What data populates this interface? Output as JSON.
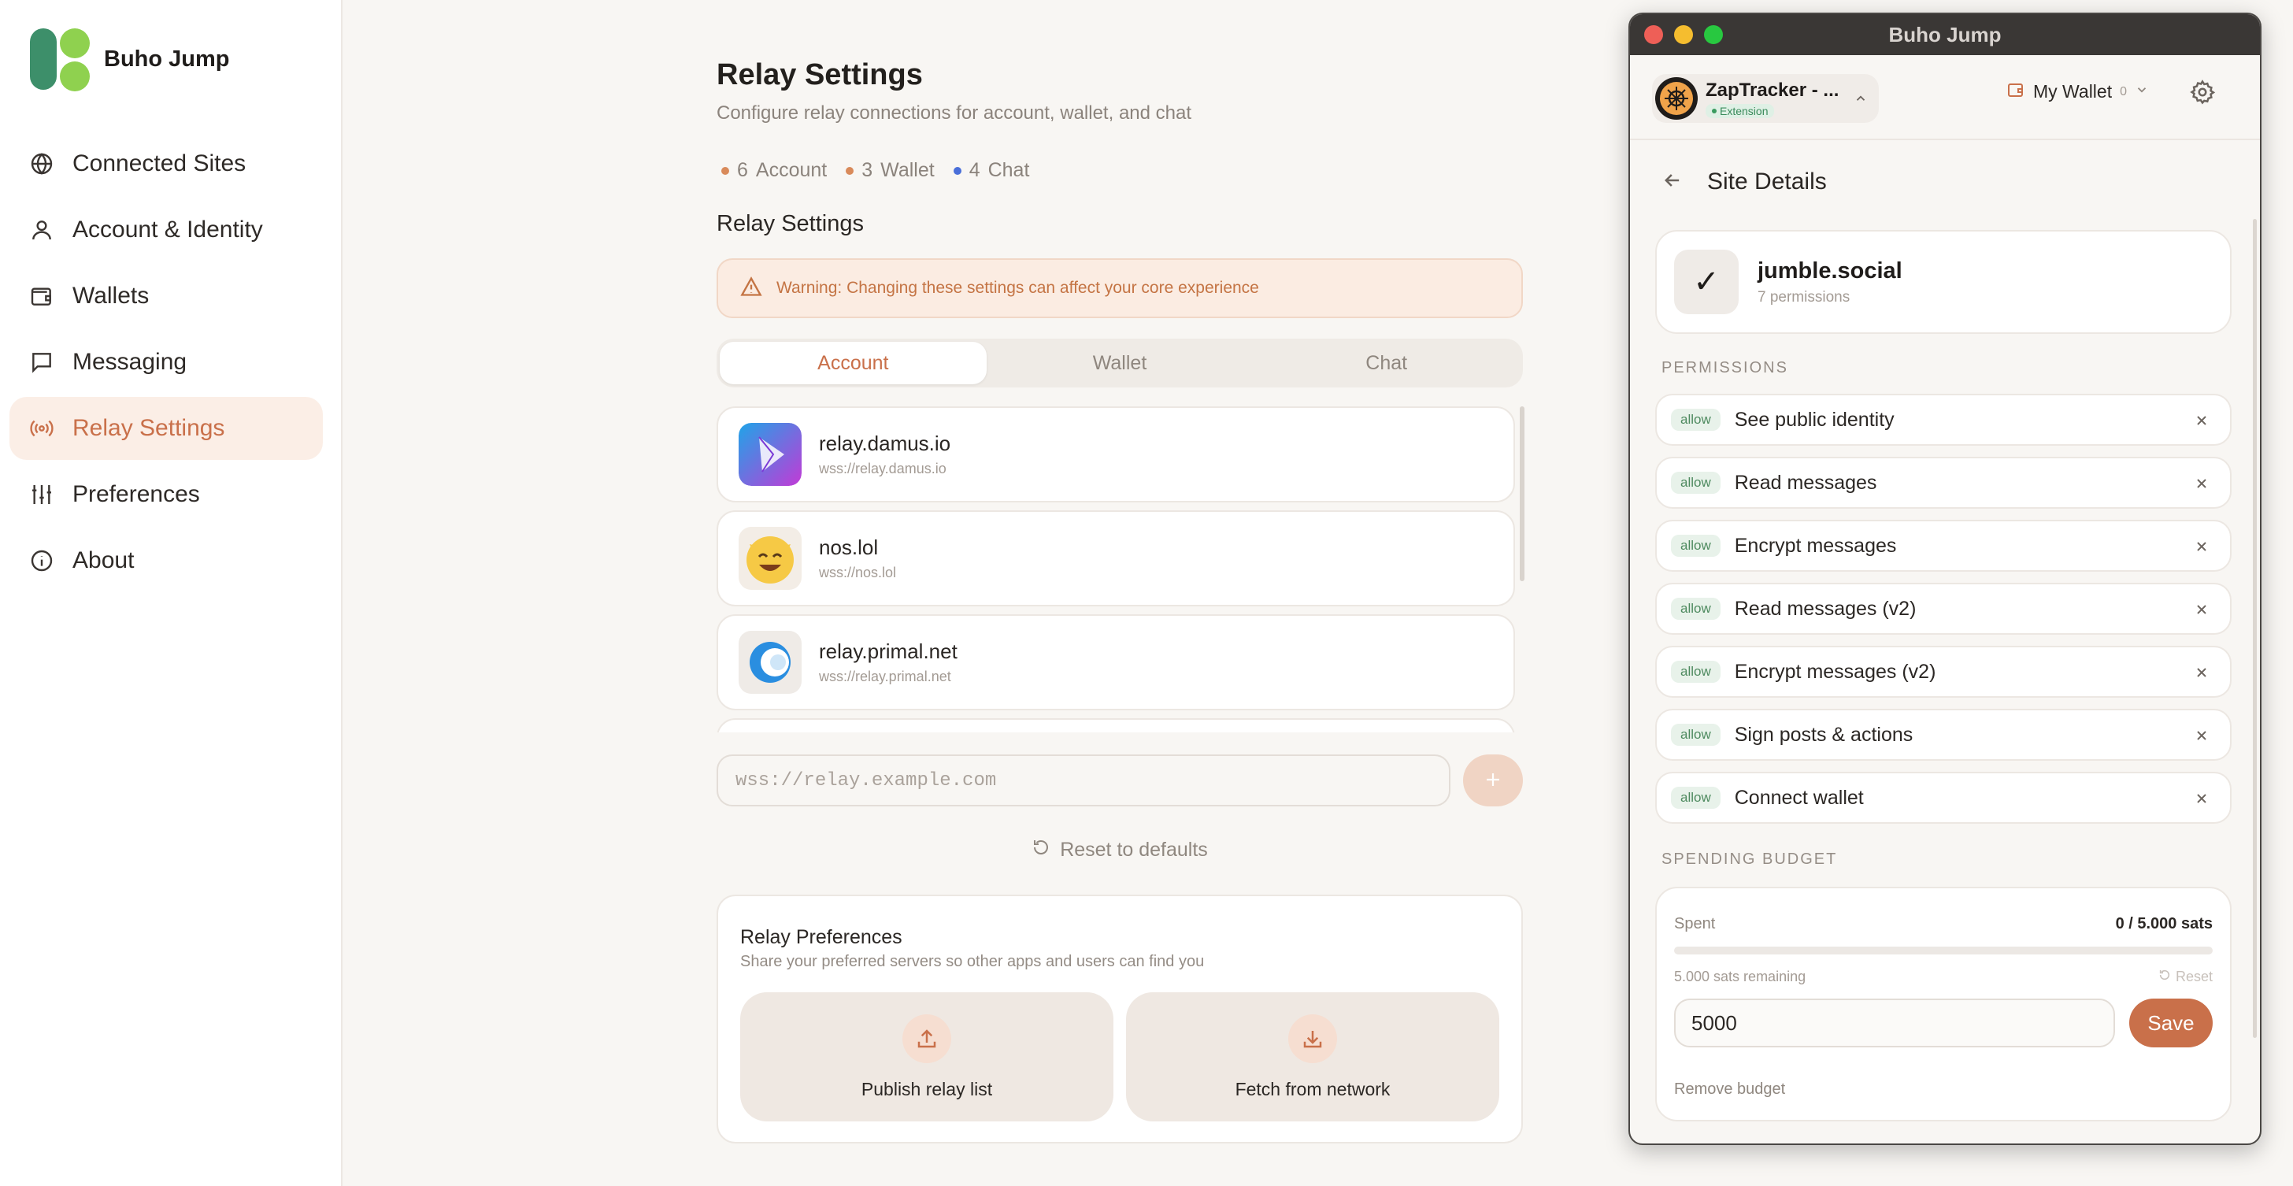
{
  "brand": {
    "name": "Buho Jump"
  },
  "sidebar": {
    "items": [
      {
        "label": "Connected Sites",
        "icon": "globe-icon",
        "active": false
      },
      {
        "label": "Account & Identity",
        "icon": "user-icon",
        "active": false
      },
      {
        "label": "Wallets",
        "icon": "wallet-icon",
        "active": false
      },
      {
        "label": "Messaging",
        "icon": "message-icon",
        "active": false
      },
      {
        "label": "Relay Settings",
        "icon": "broadcast-icon",
        "active": true
      },
      {
        "label": "Preferences",
        "icon": "sliders-icon",
        "active": false
      },
      {
        "label": "About",
        "icon": "info-icon",
        "active": false
      }
    ]
  },
  "main": {
    "title": "Relay Settings",
    "subtitle": "Configure relay connections for account, wallet, and chat",
    "counts": [
      {
        "value": "6",
        "label": "Account",
        "color": "#d98a5a"
      },
      {
        "value": "3",
        "label": "Wallet",
        "color": "#d98a5a"
      },
      {
        "value": "4",
        "label": "Chat",
        "color": "#4a6fd9"
      }
    ],
    "section_title": "Relay Settings",
    "warning": "Warning: Changing these settings can affect your core experience",
    "tabs": [
      {
        "label": "Account",
        "active": true
      },
      {
        "label": "Wallet",
        "active": false
      },
      {
        "label": "Chat",
        "active": false
      }
    ],
    "relays": [
      {
        "name": "relay.damus.io",
        "url": "wss://relay.damus.io"
      },
      {
        "name": "nos.lol",
        "url": "wss://nos.lol"
      },
      {
        "name": "relay.primal.net",
        "url": "wss://relay.primal.net"
      }
    ],
    "add_input": {
      "placeholder": "wss://relay.example.com",
      "value": ""
    },
    "reset_label": "Reset to defaults",
    "prefs": {
      "title": "Relay Preferences",
      "subtitle": "Share your preferred servers so other apps and users can find you",
      "publish_label": "Publish relay list",
      "fetch_label": "Fetch from network"
    }
  },
  "popup": {
    "window_title": "Buho Jump",
    "account": {
      "name": "ZapTracker - ...",
      "badge": "Extension"
    },
    "wallet": {
      "name": "My Wallet",
      "balance": "0"
    },
    "header": "Site Details",
    "site": {
      "name": "jumble.social",
      "permissions_count": "7 permissions",
      "icon_glyph": "✓"
    },
    "permissions_label": "PERMISSIONS",
    "permissions": [
      {
        "status": "allow",
        "label": "See public identity"
      },
      {
        "status": "allow",
        "label": "Read messages"
      },
      {
        "status": "allow",
        "label": "Encrypt messages"
      },
      {
        "status": "allow",
        "label": "Read messages (v2)"
      },
      {
        "status": "allow",
        "label": "Encrypt messages (v2)"
      },
      {
        "status": "allow",
        "label": "Sign posts & actions"
      },
      {
        "status": "allow",
        "label": "Connect wallet"
      }
    ],
    "budget_label": "SPENDING BUDGET",
    "budget": {
      "spent_label": "Spent",
      "amount": "0 / 5.000 sats",
      "progress_fraction": 0,
      "remaining": "5.000 sats remaining",
      "reset_label": "Reset",
      "input_value": "5000",
      "save_label": "Save",
      "remove_label": "Remove budget"
    }
  },
  "colors": {
    "accent": "#c9704a",
    "active_bg": "#fbeee6"
  }
}
